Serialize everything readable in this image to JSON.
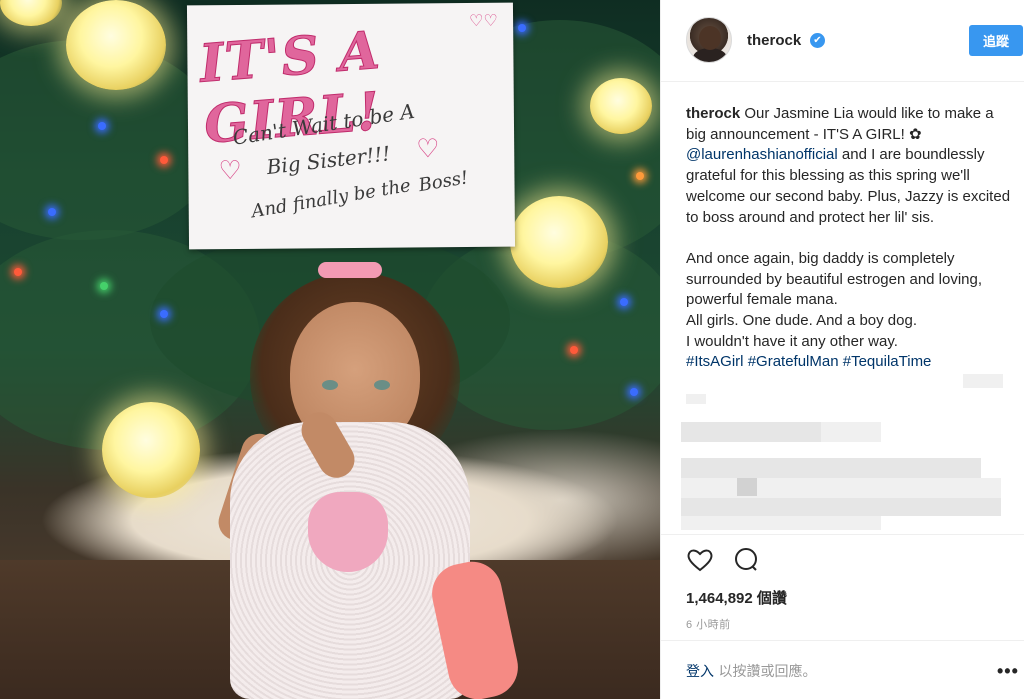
{
  "post": {
    "photo_alt": "Child sitting under a Christmas tree holding a sign",
    "sign": {
      "title": "IT'S A GIRL!",
      "line1": "Can't Wait to be A",
      "line2": "Big Sister!!!",
      "line3": "And finally be the",
      "line4": "Boss!"
    }
  },
  "header": {
    "username": "therock",
    "verified_mark": "✔",
    "follow_label": "追蹤"
  },
  "caption": {
    "username": "therock",
    "line_1": " Our Jasmine Lia would like to make a big announcement - IT'S A GIRL! ✿ ",
    "mention": "@laurenhashianofficial",
    "line_2": " and I are boundlessly grateful for this blessing as this spring we'll welcome our second baby. Plus, Jazzy is excited to boss around and protect her lil' sis.",
    "para2_l1": "And once again, big daddy is completely surrounded by beautiful estrogen and loving, powerful female mana.",
    "para2_l2": "All girls. One dude. And a boy dog.",
    "para2_l3": "I wouldn't have it any other way.",
    "hashtag_1": "#ItsAGirl",
    "hashtag_2": "#GratefulMan",
    "hashtag_3": "#TequilaTime"
  },
  "stats": {
    "likes": "1,464,892 個讚",
    "time": "6 小時前"
  },
  "footer": {
    "login_link": "登入",
    "login_rest": " 以按讚或回應。",
    "more": "•••"
  },
  "icons": [
    "heart-icon",
    "comment-icon",
    "verified-badge-icon",
    "more-options-icon"
  ]
}
